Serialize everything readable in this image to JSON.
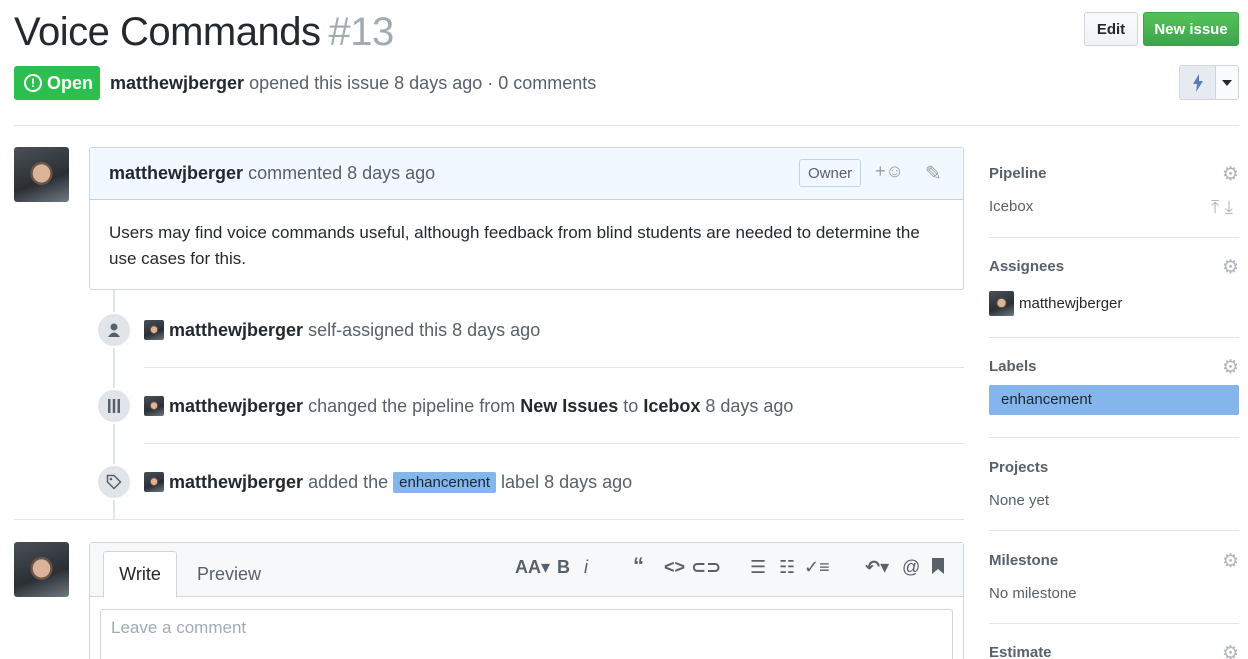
{
  "issue": {
    "title": "Voice Commands",
    "number": "#13",
    "state": "Open",
    "author": "matthewjberger",
    "meta_text": "opened this issue 8 days ago · 0 comments"
  },
  "header_buttons": {
    "edit": "Edit",
    "new_issue": "New issue"
  },
  "comment": {
    "author": "matthewjberger",
    "action": "commented 8 days ago",
    "role": "Owner",
    "body": "Users may find voice commands useful, although feedback from blind students are needed to determine the use cases for this."
  },
  "events": [
    {
      "user": "matthewjberger",
      "text": "self-assigned this 8 days ago"
    },
    {
      "user": "matthewjberger",
      "t1": "changed the pipeline from",
      "from": "New Issues",
      "t2": "to",
      "to": "Icebox",
      "t3": "8 days ago"
    },
    {
      "user": "matthewjberger",
      "t1": "added the",
      "label": "enhancement",
      "t2": "label 8 days ago"
    }
  ],
  "editor": {
    "tab_write": "Write",
    "tab_preview": "Preview",
    "placeholder": "Leave a comment"
  },
  "sidebar": {
    "pipeline": {
      "heading": "Pipeline",
      "value": "Icebox"
    },
    "assignees": {
      "heading": "Assignees",
      "value": "matthewjberger"
    },
    "labels": {
      "heading": "Labels",
      "value": "enhancement"
    },
    "projects": {
      "heading": "Projects",
      "value": "None yet"
    },
    "milestone": {
      "heading": "Milestone",
      "value": "No milestone"
    },
    "estimate": {
      "heading": "Estimate"
    }
  },
  "colors": {
    "open_green": "#2cbe4e",
    "new_issue_green": "#3da44c",
    "label_blue": "#84b6eb"
  }
}
